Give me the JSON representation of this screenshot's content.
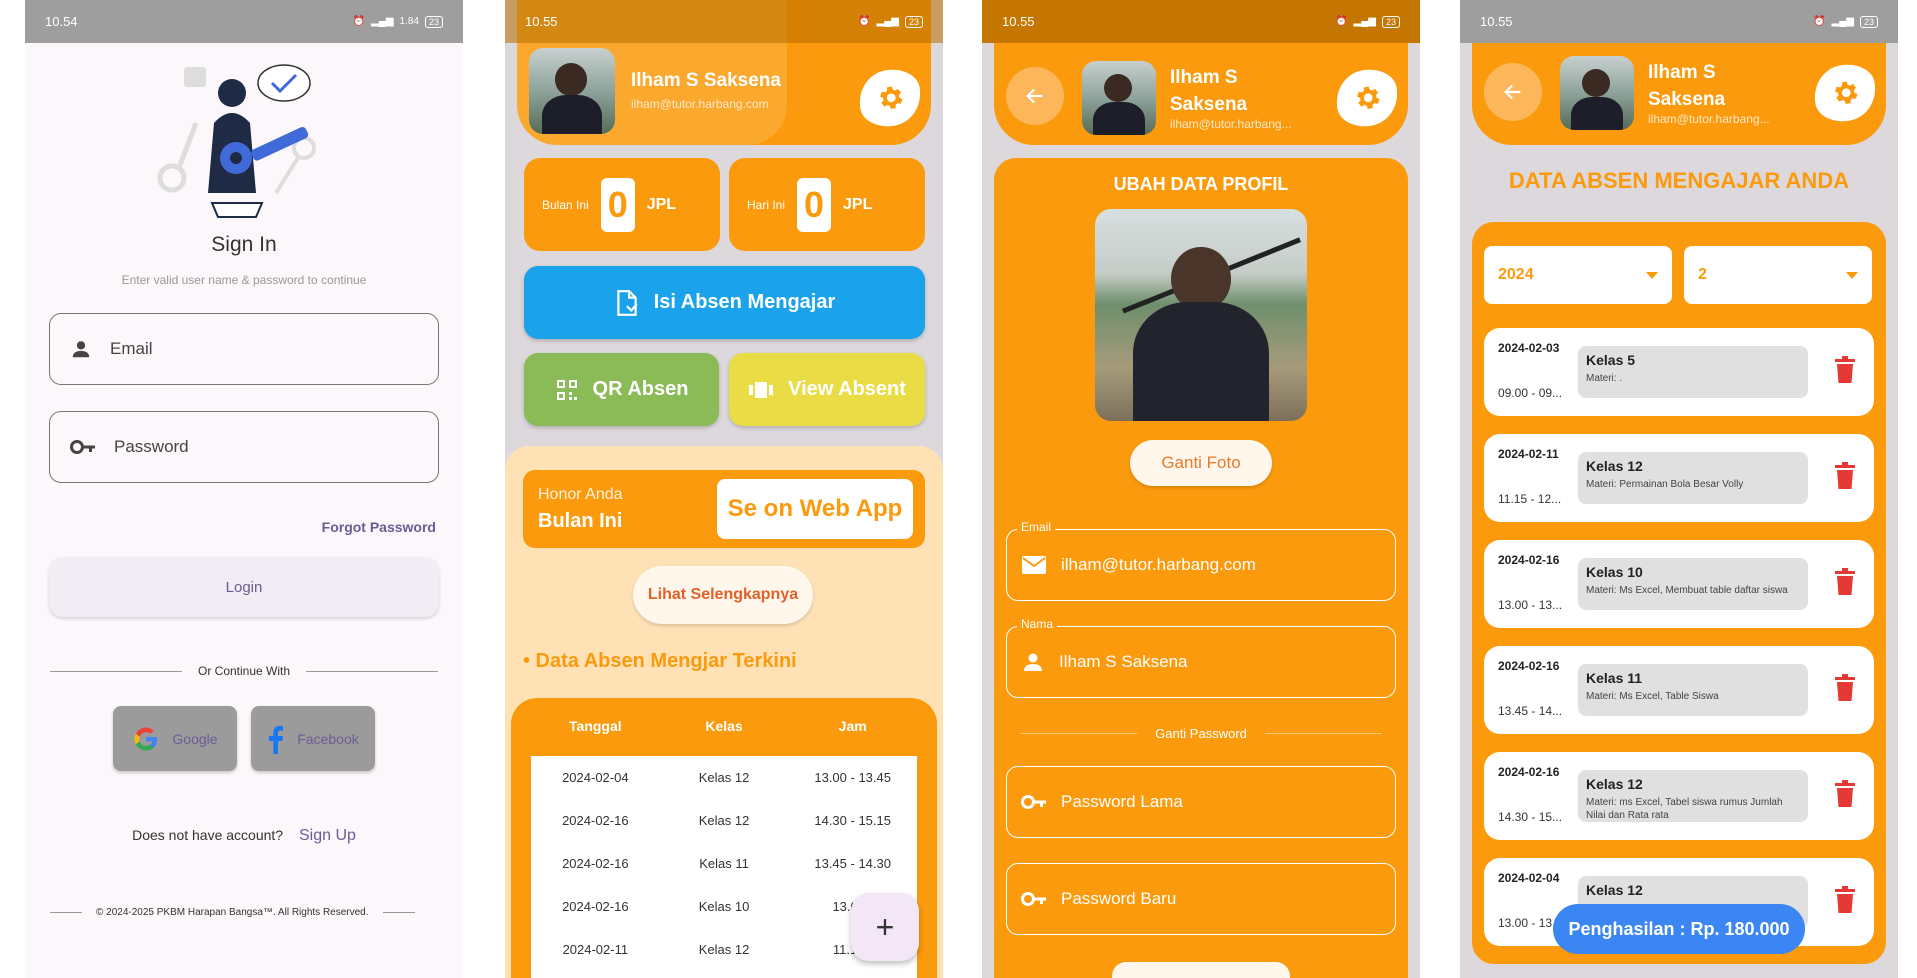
{
  "phone1": {
    "status_time": "10.54",
    "status_net": "1.84",
    "battery": "23",
    "title": "Sign In",
    "subtitle": "Enter valid user name & password to continue",
    "email_placeholder": "Email",
    "password_placeholder": "Password",
    "forgot": "Forgot Password",
    "login": "Login",
    "or_continue": "Or Continue With",
    "google": "Google",
    "facebook": "Facebook",
    "no_account": "Does not have account?",
    "sign_up": "Sign Up",
    "copyright": "© 2024-2025 PKBM Harapan Bangsa™. All Rights Reserved."
  },
  "phone2": {
    "status_time": "10.55",
    "battery": "23",
    "name": "Ilham S Saksena",
    "email": "ilham@tutor.harbang.com",
    "bulan_label": "Bulan Ini",
    "bulan_value": "0",
    "hari_label": "Hari Ini",
    "hari_value": "0",
    "unit": "JPL",
    "isi_absen": "Isi Absen Mengajar",
    "qr_absen": "QR Absen",
    "view_absent": "View Absent",
    "honor_line1": "Honor Anda",
    "honor_line2": "Bulan Ini",
    "web_app": "Se on Web App",
    "lihat": "Lihat Selengkapnya",
    "section_title": "• Data Absen Mengjar Terkini",
    "table_headers": [
      "Tanggal",
      "Kelas",
      "Jam"
    ],
    "rows": [
      [
        "2024-02-04",
        "Kelas 12",
        "13.00 - 13.45"
      ],
      [
        "2024-02-16",
        "Kelas 12",
        "14.30 - 15.15"
      ],
      [
        "2024-02-16",
        "Kelas 11",
        "13.45 - 14.30"
      ],
      [
        "2024-02-16",
        "Kelas 10",
        "13.00 -"
      ],
      [
        "2024-02-11",
        "Kelas 12",
        "11.15 -"
      ]
    ],
    "fab": "+"
  },
  "phone3": {
    "status_time": "10.55",
    "battery": "23",
    "name": "Ilham S Saksena",
    "email": "ilham@tutor.harbang...",
    "title": "UBAH DATA PROFIL",
    "ganti_foto": "Ganti Foto",
    "email_label": "Email",
    "email_value": "ilham@tutor.harbang.com",
    "nama_label": "Nama",
    "nama_value": "Ilham S Saksena",
    "ganti_password": "Ganti Password",
    "password_lama": "Password Lama",
    "password_baru": "Password Baru"
  },
  "phone4": {
    "status_time": "10.55",
    "battery": "23",
    "name": "Ilham S Saksena",
    "email": "ilham@tutor.harbang...",
    "title": "DATA ABSEN MENGAJAR ANDA",
    "year": "2024",
    "month": "2",
    "records": [
      {
        "date": "2024-02-03",
        "time": "09.00 - 09...",
        "kelas": "Kelas 5",
        "materi": "Materi: ."
      },
      {
        "date": "2024-02-11",
        "time": "11.15 - 12...",
        "kelas": "Kelas 12",
        "materi": "Materi: Permainan Bola Besar Volly"
      },
      {
        "date": "2024-02-16",
        "time": "13.00 - 13...",
        "kelas": "Kelas 10",
        "materi": "Materi: Ms Excel, Membuat table daftar siswa"
      },
      {
        "date": "2024-02-16",
        "time": "13.45 - 14...",
        "kelas": "Kelas 11",
        "materi": "Materi: Ms Excel, Table Siswa"
      },
      {
        "date": "2024-02-16",
        "time": "14.30 - 15...",
        "kelas": "Kelas 12",
        "materi": "Materi: ms Excel, Tabel siswa rumus Jumlah Nilai dan Rata rata"
      },
      {
        "date": "2024-02-04",
        "time": "13.00 - 13...",
        "kelas": "Kelas 12",
        "materi": ""
      }
    ],
    "penghasilan": "Penghasilan : Rp. 180.000"
  },
  "colors": {
    "orange": "#fb9a0c",
    "blue_button": "#1aa3ea",
    "green_button": "#8bbb56",
    "yellow_button": "#e9dc45",
    "delete_red": "#e53935"
  }
}
